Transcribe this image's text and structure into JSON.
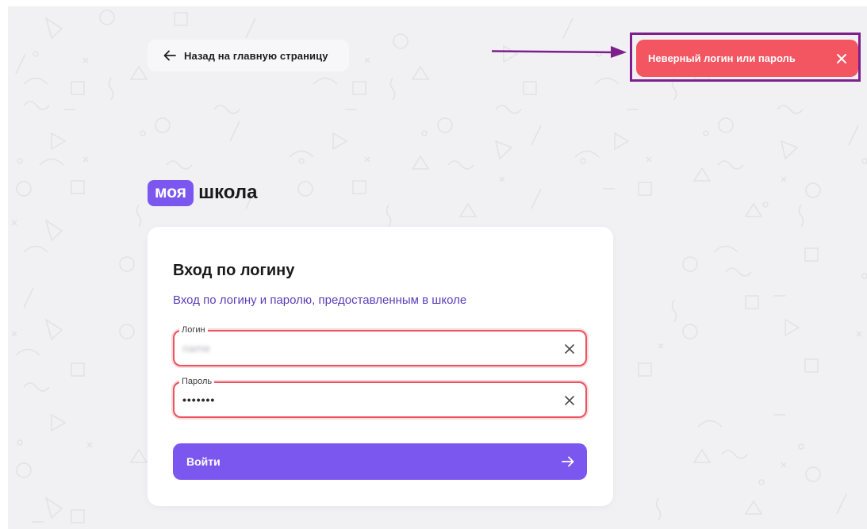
{
  "back_link": {
    "label": "Назад на главную страницу",
    "icon": "arrow-left-icon"
  },
  "toast": {
    "message": "Неверный логин или пароль",
    "close_icon": "close-icon",
    "background": "#f35561"
  },
  "annotation": {
    "frame_color": "#7d1f8c"
  },
  "logo": {
    "badge_text": "моя",
    "word_text": "школа",
    "accent": "#7b57f0"
  },
  "login_card": {
    "title": "Вход по логину",
    "subtitle": "Вход по логину и паролю, предоставленным в школе",
    "fields": {
      "login": {
        "legend": "Логин",
        "value": "name"
      },
      "password": {
        "legend": "Пароль",
        "value": "•••••••"
      }
    },
    "submit_label": "Войти",
    "submit_icon": "arrow-right-icon",
    "error_color": "#e9535e"
  }
}
